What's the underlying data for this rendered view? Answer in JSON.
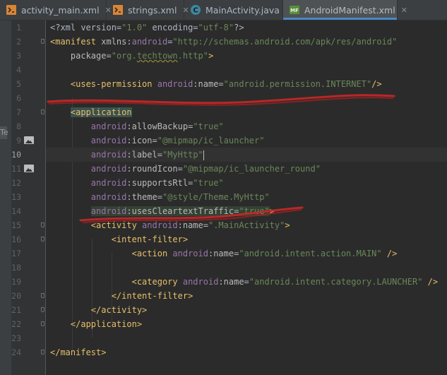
{
  "tabs": [
    {
      "label": "activity_main.xml",
      "icon": "xml-file-icon",
      "active": false
    },
    {
      "label": "strings.xml",
      "icon": "xml-file-icon",
      "active": false
    },
    {
      "label": "MainActivity.java",
      "icon": "java-class-icon",
      "active": false
    },
    {
      "label": "AndroidManifest.xml",
      "icon": "manifest-file-icon",
      "active": true
    }
  ],
  "left_panel_glyph": "Te",
  "editor": {
    "current_line": "10",
    "lines": [
      {
        "n": "1"
      },
      {
        "n": "2"
      },
      {
        "n": "3"
      },
      {
        "n": "4"
      },
      {
        "n": "5"
      },
      {
        "n": "6"
      },
      {
        "n": "7"
      },
      {
        "n": "8"
      },
      {
        "n": "9"
      },
      {
        "n": "10"
      },
      {
        "n": "11"
      },
      {
        "n": "12"
      },
      {
        "n": "13"
      },
      {
        "n": "14"
      },
      {
        "n": "15"
      },
      {
        "n": "16"
      },
      {
        "n": "17"
      },
      {
        "n": "18"
      },
      {
        "n": "19"
      },
      {
        "n": "20"
      },
      {
        "n": "21"
      },
      {
        "n": "22"
      },
      {
        "n": "23"
      },
      {
        "n": "24"
      }
    ],
    "tok": {
      "l1_a": "<?xml version=",
      "l1_b": "\"1.0\"",
      "l1_c": " encoding=",
      "l1_d": "\"utf-8\"",
      "l1_e": "?>",
      "l2_a": "<manifest",
      "l2_b": " xmlns:",
      "l2_c": "android",
      "l2_d": "=",
      "l2_e": "\"http://schemas.android.com/apk/res/android\"",
      "l3_a": "package",
      "l3_b": "=",
      "l3_c": "\"org.",
      "l3_d": "techtown",
      "l3_e": ".http\"",
      "l3_f": ">",
      "l5_a": "<uses-permission",
      "l5_b": " android",
      "l5_c": ":name",
      "l5_d": "=",
      "l5_e": "\"android.permission.INTERNET\"",
      "l5_f": "/>",
      "l7_a": "<application",
      "l8_a": "android",
      "l8_b": ":allowBackup",
      "l8_c": "=",
      "l8_d": "\"true\"",
      "l9_a": "android",
      "l9_b": ":icon",
      "l9_c": "=",
      "l9_d": "\"@mipmap/ic_launcher\"",
      "l10_a": "android",
      "l10_b": ":label",
      "l10_c": "=",
      "l10_d": "\"MyHttp\"",
      "l11_a": "android",
      "l11_b": ":roundIcon",
      "l11_c": "=",
      "l11_d": "\"@mipmap/ic_launcher_round\"",
      "l12_a": "android",
      "l12_b": ":supportsRtl",
      "l12_c": "=",
      "l12_d": "\"true\"",
      "l13_a": "android",
      "l13_b": ":theme",
      "l13_c": "=",
      "l13_d": "\"@style/Theme.MyHttp\"",
      "l14_a": "android",
      "l14_b": ":usesCleartextTraffic",
      "l14_c": "=",
      "l14_d": "\"true\"",
      "l14_e": ">",
      "l15_a": "<activity",
      "l15_b": " android",
      "l15_c": ":name",
      "l15_d": "=",
      "l15_e": "\".MainActivity\"",
      "l15_f": ">",
      "l16_a": "<intent-filter",
      "l16_b": ">",
      "l17_a": "<action",
      "l17_b": " android",
      "l17_c": ":name",
      "l17_d": "=",
      "l17_e": "\"android.intent.action.MAIN\"",
      "l17_f": " />",
      "l19_a": "<category",
      "l19_b": " android",
      "l19_c": ":name",
      "l19_d": "=",
      "l19_e": "\"android.intent.category.LAUNCHER\"",
      "l19_f": " />",
      "l20_a": "</intent-filter>",
      "l21_a": "</activity>",
      "l22_a": "</application>",
      "l24_a": "</manifest>"
    }
  },
  "colors": {
    "background": "#2b2b2b",
    "gutter": "#313335",
    "tag": "#e8bf6a",
    "attribute_namespace": "#9876aa",
    "attribute_name": "#bababa",
    "string": "#6a8759",
    "annotation_stroke": "#c62828"
  }
}
